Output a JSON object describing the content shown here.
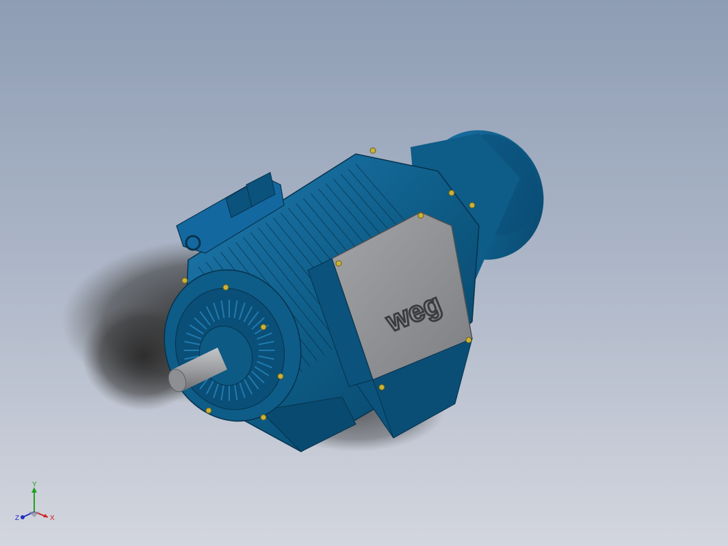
{
  "model": {
    "logo_text": "weg",
    "colors": {
      "body": "#0d5a84",
      "body_dark": "#083f60",
      "body_light": "#1f7bb0",
      "terminal_box": "#8f9194",
      "terminal_box_dark": "#6f7174",
      "shaft": "#9c9ea1",
      "bolt": "#c9b23a"
    }
  },
  "triad": {
    "x_label": "X",
    "y_label": "Y",
    "z_label": "Z",
    "colors": {
      "x": "#d02020",
      "y": "#20a020",
      "z": "#2030c0"
    }
  }
}
